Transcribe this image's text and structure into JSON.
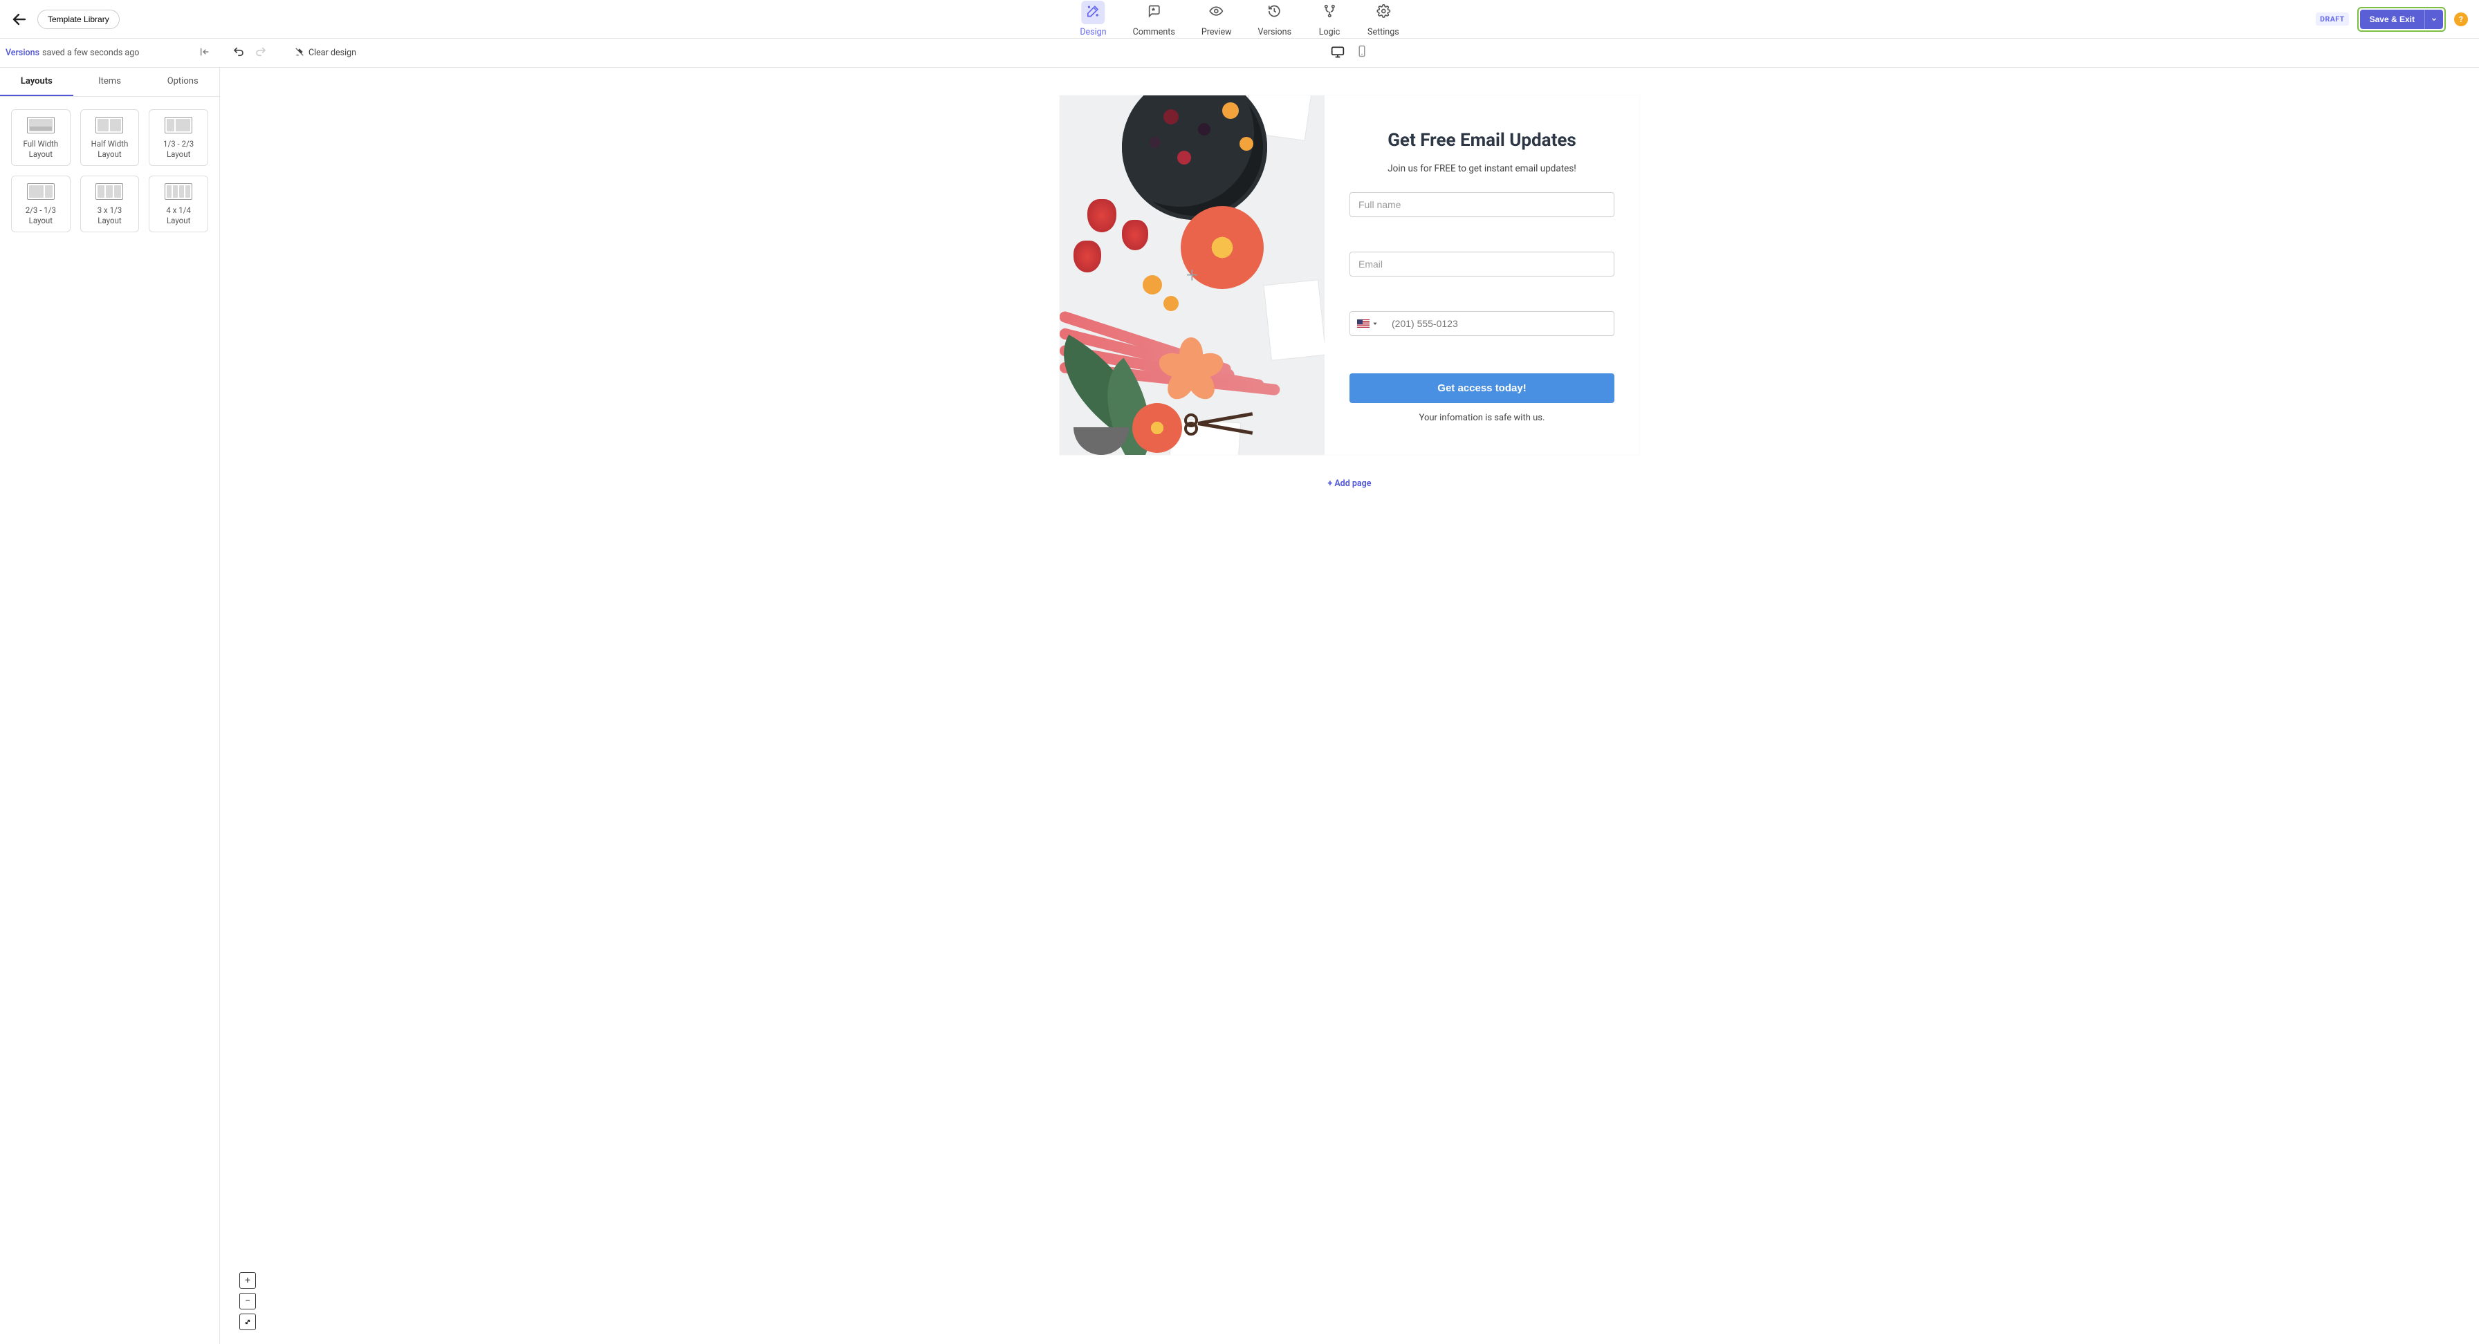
{
  "topbar": {
    "template_library": "Template Library",
    "nav": [
      {
        "key": "design",
        "label": "Design"
      },
      {
        "key": "comments",
        "label": "Comments"
      },
      {
        "key": "preview",
        "label": "Preview"
      },
      {
        "key": "versions",
        "label": "Versions"
      },
      {
        "key": "logic",
        "label": "Logic"
      },
      {
        "key": "settings",
        "label": "Settings"
      }
    ],
    "draft_badge": "DRAFT",
    "save_exit": "Save & Exit"
  },
  "secondbar": {
    "versions_link": "Versions",
    "saved_text": "saved a few seconds ago",
    "clear_design": "Clear design"
  },
  "sidebar": {
    "tabs": {
      "layouts": "Layouts",
      "items": "Items",
      "options": "Options"
    },
    "layouts": [
      {
        "key": "full",
        "label": "Full Width Layout"
      },
      {
        "key": "half",
        "label": "Half Width Layout"
      },
      {
        "key": "1323",
        "label": "1/3 - 2/3 Layout"
      },
      {
        "key": "2313",
        "label": "2/3 - 1/3 Layout"
      },
      {
        "key": "3x",
        "label": "3 x 1/3 Layout"
      },
      {
        "key": "4x",
        "label": "4 x 1/4 Layout"
      }
    ]
  },
  "canvas": {
    "title": "Get Free Email Updates",
    "subtitle": "Join us for FREE to get instant email updates!",
    "fullname_placeholder": "Full name",
    "email_placeholder": "Email",
    "phone_placeholder": "(201) 555-0123",
    "cta": "Get access today!",
    "footer": "Your infomation is safe with us.",
    "add_page": "Add page"
  }
}
